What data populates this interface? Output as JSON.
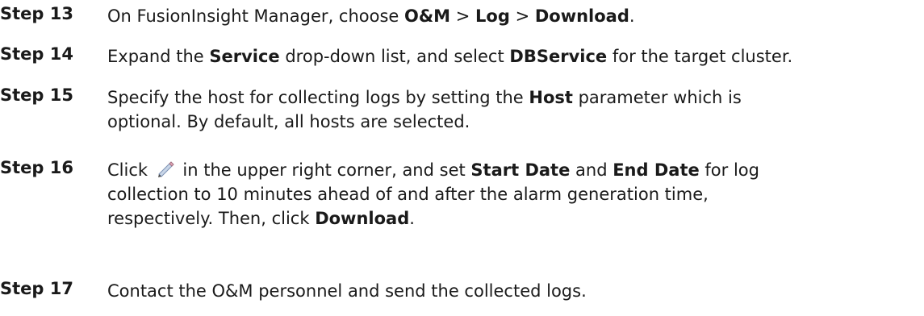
{
  "steps": [
    {
      "label": "Step 13",
      "t1": "On FusionInsight Manager, choose ",
      "b1": "O&M",
      "t2": " > ",
      "b2": "Log",
      "t3": " > ",
      "b3": "Download",
      "t4": "."
    },
    {
      "label": "Step 14",
      "t1": "Expand the ",
      "b1": "Service",
      "t2": " drop-down list, and select ",
      "b2": "DBService",
      "t3": " for the target cluster."
    },
    {
      "label": "Step 15",
      "t1": "Specify the host for collecting logs by setting the ",
      "b1": "Host",
      "t2": " parameter which is",
      "line2": "optional. By default, all hosts are selected."
    },
    {
      "label": "Step 16",
      "t1": "Click ",
      "icon": "pencil-icon",
      "t2": " in the upper right corner, and set ",
      "b1": "Start Date",
      "t3": " and ",
      "b2": "End Date",
      "t4": " for log",
      "line2": "collection to 10 minutes ahead of and after the alarm generation time,",
      "line3a": "respectively. Then, click ",
      "b3": "Download",
      "line3b": "."
    },
    {
      "label": "Step 17",
      "t1": "Contact the O&M personnel and send the collected logs."
    }
  ]
}
